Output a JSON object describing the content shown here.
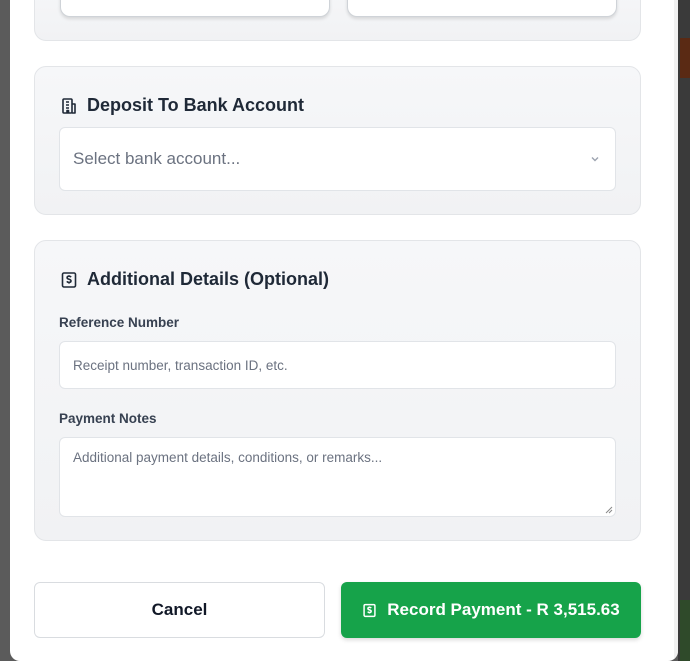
{
  "sections": {
    "bank": {
      "title": "Deposit To Bank Account",
      "select": {
        "placeholder": "Select bank account..."
      }
    },
    "details": {
      "title": "Additional Details (Optional)",
      "reference": {
        "label": "Reference Number",
        "placeholder": "Receipt number, transaction ID, etc."
      },
      "notes": {
        "label": "Payment Notes",
        "placeholder": "Additional payment details, conditions, or remarks..."
      }
    }
  },
  "actions": {
    "cancel_label": "Cancel",
    "record_label": "Record Payment - R 3,515.63"
  },
  "icons": {
    "bank": "building-icon",
    "details": "receipt-dollar-icon",
    "select_chevron": "chevron-down-icon",
    "record": "receipt-dollar-icon"
  },
  "colors": {
    "primary": "#16a34a",
    "card_bg": "#f4f5f7",
    "text": "#1f2937",
    "placeholder": "#6b7280"
  }
}
